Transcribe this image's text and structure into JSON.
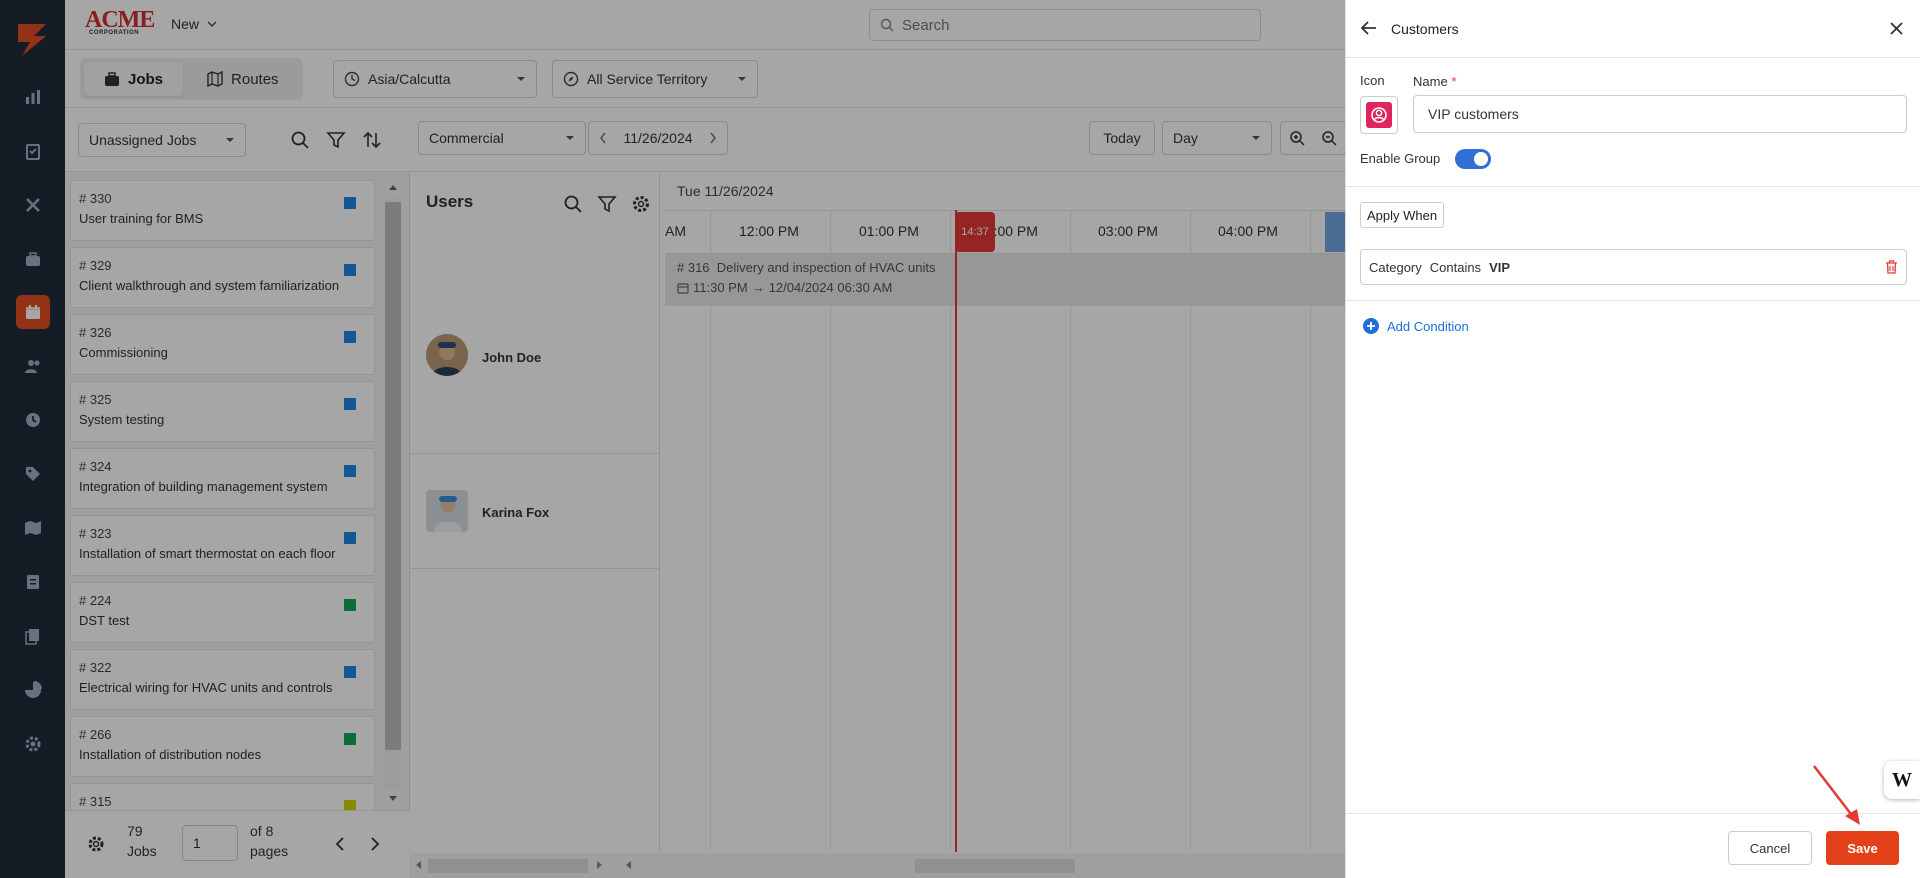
{
  "brand": {
    "name": "ACME",
    "sub": "CORPORATION"
  },
  "topbar": {
    "new_label": "New",
    "search_placeholder": "Search"
  },
  "toolbar": {
    "tabs": [
      {
        "label": "Jobs",
        "active": true
      },
      {
        "label": "Routes",
        "active": false
      }
    ],
    "timezone": "Asia/Calcutta",
    "territory": "All Service Territory"
  },
  "jobs_panel": {
    "filter": "Unassigned Jobs",
    "jobs": [
      {
        "num": "# 330",
        "title": "User training for BMS",
        "color": "#1e88e5"
      },
      {
        "num": "# 329",
        "title": "Client walkthrough and system familiarization",
        "color": "#1e88e5"
      },
      {
        "num": "# 326",
        "title": "Commissioning",
        "color": "#1e88e5"
      },
      {
        "num": "# 325",
        "title": "System testing",
        "color": "#1e88e5"
      },
      {
        "num": "# 324",
        "title": "Integration of building management system",
        "color": "#1e88e5"
      },
      {
        "num": "# 323",
        "title": "Installation of smart thermostat on each floor",
        "color": "#1e88e5"
      },
      {
        "num": "# 224",
        "title": "DST test",
        "color": "#12a85a"
      },
      {
        "num": "# 322",
        "title": "Electrical wiring for HVAC units and controls",
        "color": "#1e88e5"
      },
      {
        "num": "# 266",
        "title": "Installation of distribution nodes",
        "color": "#12a85a"
      },
      {
        "num": "# 315",
        "title": "",
        "color": "#d4d400"
      }
    ],
    "footer": {
      "count": "79",
      "count_label": "Jobs",
      "page": "1",
      "of_label": "of 8",
      "pages_label": "pages"
    }
  },
  "scheduler": {
    "category": "Commercial",
    "date": "11/26/2024",
    "today_label": "Today",
    "view": "Day",
    "users_title": "Users",
    "users": [
      {
        "name": "John Doe"
      },
      {
        "name": "Karina Fox"
      }
    ],
    "grid_date": "Tue 11/26/2024",
    "hours": [
      "AM",
      "12:00 PM",
      "01:00 PM",
      "02:00 PM",
      "03:00 PM",
      "04:00 PM"
    ],
    "now": "14:37",
    "event": {
      "num": "# 316",
      "title": "Delivery and inspection of HVAC units",
      "start": "11:30 PM",
      "end": "12/04/2024 06:30 AM"
    }
  },
  "drawer": {
    "title": "Customers",
    "icon_label": "Icon",
    "name_label": "Name",
    "name_required": "*",
    "name_value": "VIP customers",
    "enable_label": "Enable Group",
    "apply_when": "Apply When",
    "condition": {
      "field": "Category",
      "op": "Contains",
      "value": "VIP"
    },
    "add_condition": "Add Condition",
    "cancel": "Cancel",
    "save": "Save",
    "badge": "W"
  },
  "colors": {
    "accent": "#e2411a",
    "toggle": "#2f6fd6",
    "link": "#1e6fd9",
    "icon_bg": "#e0245e",
    "nav": "#1f2c3a",
    "now": "#e53935"
  }
}
